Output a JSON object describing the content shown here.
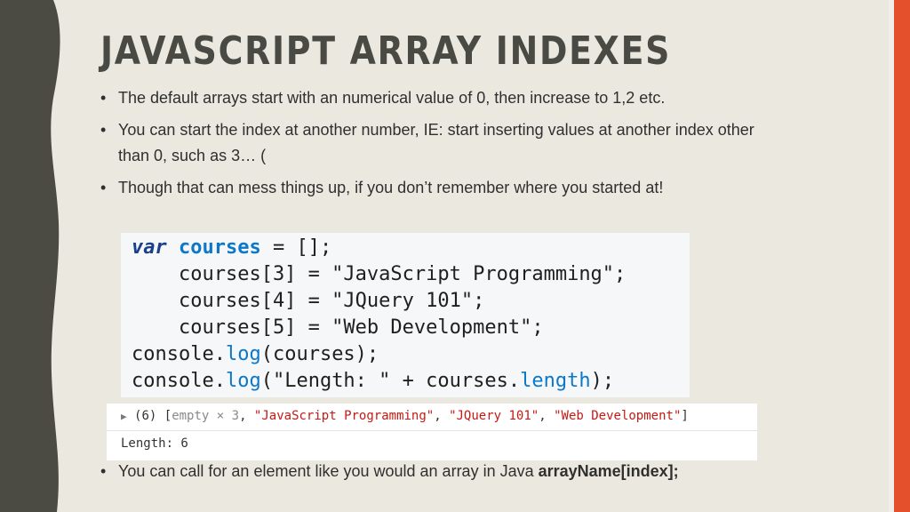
{
  "slide": {
    "title": "JAVASCRIPT ARRAY INDEXES",
    "bullet_char": "•",
    "bullets": [
      {
        "lines": [
          "The default arrays start with an numerical value of 0, then increase to 1,2 etc."
        ]
      },
      {
        "lines": [
          "You can start the index at another number,  IE: start inserting values at another index other",
          "than 0, such as 3…  ("
        ]
      },
      {
        "lines": [
          "Though that can mess things up, if you don’t remember where you started at!"
        ]
      },
      {
        "lines": [
          "You can call for an element like you would an array in Java "
        ],
        "bold_suffix": "arrayName[index];"
      }
    ]
  },
  "code": {
    "l1": {
      "kw": "var",
      "ident": "courses",
      "rest": " = [];"
    },
    "l2": "    courses[3] = \"JavaScript Programming\";",
    "l3": "    courses[4] = \"JQuery 101\";",
    "l4": "    courses[5] = \"Web Development\";",
    "l5": {
      "pre": "console.",
      "method": "log",
      "post": "(courses);"
    },
    "l6": {
      "pre": "console.",
      "method": "log",
      "arg1": "(\"Length: \" + courses.",
      "prop": "length",
      "post": ");"
    }
  },
  "console": {
    "row1": {
      "triangle": "▶",
      "count": " (6) [",
      "empty": "empty × 3",
      "sep1": ", ",
      "s1": "\"JavaScript Programming\"",
      "sep2": ", ",
      "s2": "\"JQuery 101\"",
      "sep3": ", ",
      "s3": "\"Web Development\"",
      "close": "]"
    },
    "row2": "Length: 6"
  },
  "colors": {
    "band": "#4b4b44",
    "accent": "#e5502c",
    "background": "#ebe8e0"
  }
}
